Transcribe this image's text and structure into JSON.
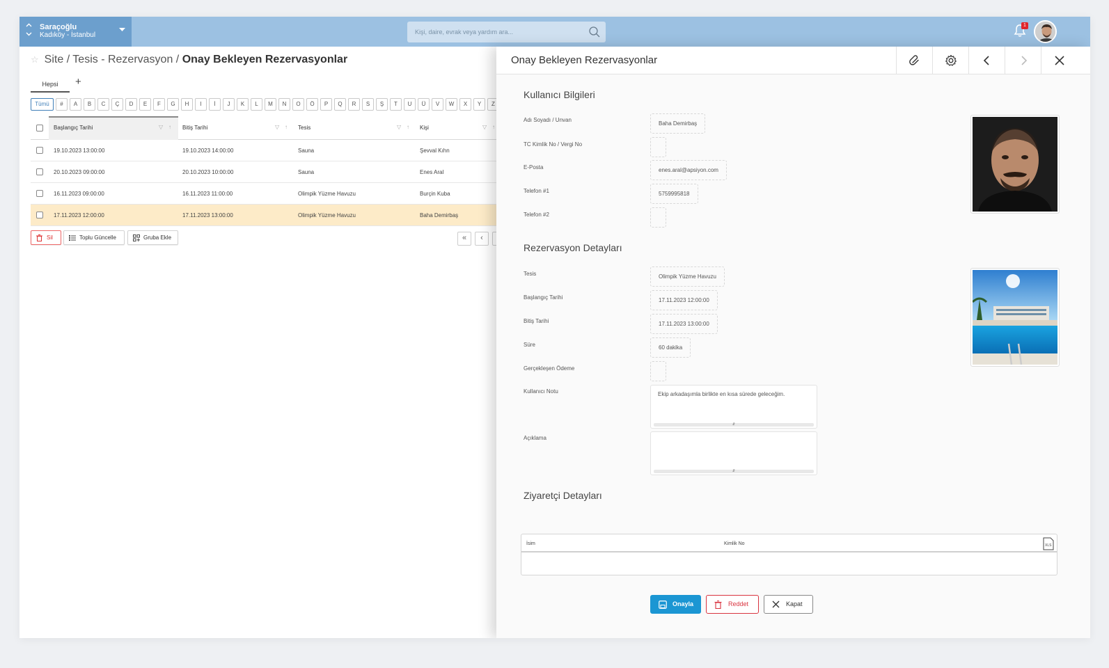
{
  "topbar": {
    "site_name": "Saraçoğlu",
    "site_location": "Kadıköy - İstanbul",
    "search_placeholder": "Kişi, daire, evrak veya yardım ara...",
    "notification_count": "1"
  },
  "breadcrumb": {
    "part1": "Site",
    "sep": "/",
    "part2": "Tesis - Rezervasyon",
    "current": "Onay Bekleyen Rezervasyonlar"
  },
  "tabs": [
    {
      "label": "Hepsi"
    }
  ],
  "alphabet": [
    "Tümü",
    "#",
    "A",
    "B",
    "C",
    "Ç",
    "D",
    "E",
    "F",
    "G",
    "H",
    "I",
    "İ",
    "J",
    "K",
    "L",
    "M",
    "N",
    "O",
    "Ö",
    "P",
    "Q",
    "R",
    "S",
    "Ş",
    "T",
    "U",
    "Ü",
    "V",
    "W",
    "X",
    "Y",
    "Z"
  ],
  "grid": {
    "columns": [
      "Başlangıç Tarihi",
      "Bitiş Tarihi",
      "Tesis",
      "Kişi"
    ],
    "rows": [
      [
        "19.10.2023 13:00:00",
        "19.10.2023 14:00:00",
        "Sauna",
        "Şevval Kıhn"
      ],
      [
        "20.10.2023 09:00:00",
        "20.10.2023 10:00:00",
        "Sauna",
        "Enes Aral"
      ],
      [
        "16.11.2023 09:00:00",
        "16.11.2023 11:00:00",
        "Olimpik Yüzme Havuzu",
        "Burçin Kuba"
      ],
      [
        "17.11.2023 12:00:00",
        "17.11.2023 13:00:00",
        "Olimpik Yüzme Havuzu",
        "Baha Demirbaş"
      ]
    ],
    "selected_row": 3
  },
  "actions": {
    "delete": "Sil",
    "bulk_update": "Toplu Güncelle",
    "add_group": "Gruba Ekle"
  },
  "drawer": {
    "title": "Onay Bekleyen Rezervasyonlar",
    "user_section": "Kullanıcı Bilgileri",
    "user_fields": {
      "name_label": "Adı Soyadı / Unvan",
      "name_value": "Baha Demirbaş",
      "tc_label": "TC Kimlik No / Vergi No",
      "tc_value": "",
      "email_label": "E-Posta",
      "email_value": "enes.aral@apsiyon.com",
      "phone1_label": "Telefon #1",
      "phone1_value": "5759995818",
      "phone2_label": "Telefon #2",
      "phone2_value": ""
    },
    "reservation_section": "Rezervasyon Detayları",
    "reservation_fields": {
      "facility_label": "Tesis",
      "facility_value": "Olimpik Yüzme Havuzu",
      "start_label": "Başlangıç Tarihi",
      "start_value": "17.11.2023 12:00:00",
      "end_label": "Bitiş Tarihi",
      "end_value": "17.11.2023 13:00:00",
      "duration_label": "Süre",
      "duration_value": "60 dakika",
      "payment_label": "Gerçekleşen Ödeme",
      "payment_value": "",
      "note_label": "Kullanıcı Notu",
      "note_value": "Ekip arkadaşımla birlikte en kısa sürede geleceğim.",
      "desc_label": "Açıklama",
      "desc_value": ""
    },
    "visitor_section": "Ziyaretçi Detayları",
    "visitor_columns": [
      "İsim",
      "Kimlik No"
    ],
    "xls_label": "XLS",
    "buttons": {
      "approve": "Onayla",
      "reject": "Reddet",
      "close": "Kapat"
    }
  },
  "colors": {
    "topbar": "#9cc1e2",
    "site_selector": "#6c9fcd",
    "primary": "#1b96d3",
    "danger": "#d9333f",
    "selected_row": "#fdebc8"
  }
}
